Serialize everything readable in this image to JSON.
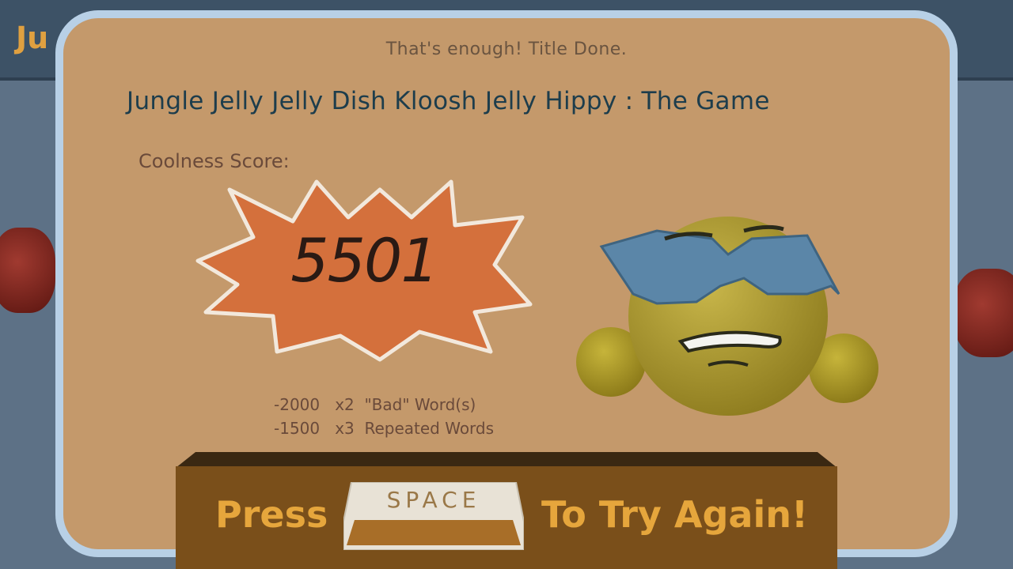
{
  "background": {
    "title_fragment": "Ju"
  },
  "dialog": {
    "subtitle": "That's enough! Title Done.",
    "game_title": "Jungle Jelly Jelly Dish Kloosh Jelly Hippy : The Game",
    "score_label": "Coolness Score:",
    "score_value": "5501",
    "penalties": [
      {
        "text": "-2000   x2  \"Bad\" Word(s)"
      },
      {
        "text": "-1500   x3  Repeated Words"
      }
    ],
    "avatar_icon": "cool-smiley-sunglasses-icon"
  },
  "prompt": {
    "press_label": "Press",
    "key_label": "SPACE",
    "action_label": "To Try Again!"
  },
  "colors": {
    "panel": "#c4996b",
    "panel_border": "#b8d0e6",
    "title": "#1d3d4c",
    "burst": "#d4703c",
    "prompt_text": "#e6a63c"
  }
}
